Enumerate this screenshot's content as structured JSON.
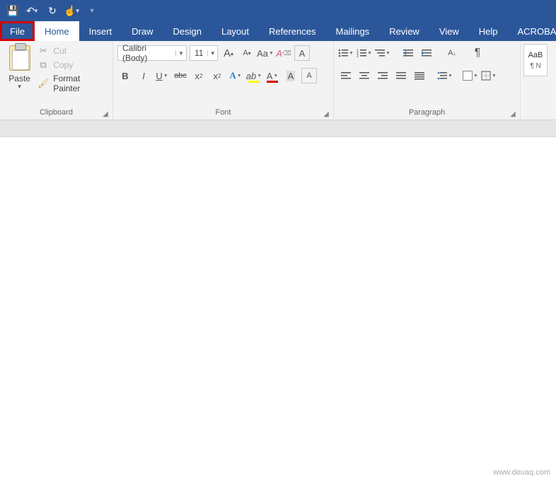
{
  "quick_access": {
    "save": "💾",
    "undo": "↶",
    "redo": "↻",
    "touch": "☝"
  },
  "tabs": {
    "file": "File",
    "home": "Home",
    "insert": "Insert",
    "draw": "Draw",
    "design": "Design",
    "layout": "Layout",
    "references": "References",
    "mailings": "Mailings",
    "review": "Review",
    "view": "View",
    "help": "Help",
    "acrobat": "ACROBAT"
  },
  "clipboard": {
    "paste": "Paste",
    "cut": "Cut",
    "copy": "Copy",
    "format_painter": "Format Painter",
    "group": "Clipboard"
  },
  "font": {
    "family": "Calibri (Body)",
    "size": "11",
    "grow": "A",
    "shrink": "A",
    "case": "Aa",
    "clear": "A",
    "bold": "B",
    "italic": "I",
    "underline": "U",
    "strike": "abc",
    "sub": "x",
    "sup": "x",
    "effects": "A",
    "highlight": "ab",
    "color": "A",
    "cchar": "A",
    "border": "A",
    "group": "Font"
  },
  "paragraph": {
    "sort": "A↓",
    "pilcrow": "¶",
    "group": "Paragraph"
  },
  "styles": {
    "box1_top": "AaB",
    "box1_bot": "¶ N"
  },
  "watermark": "www.deuaq.com"
}
